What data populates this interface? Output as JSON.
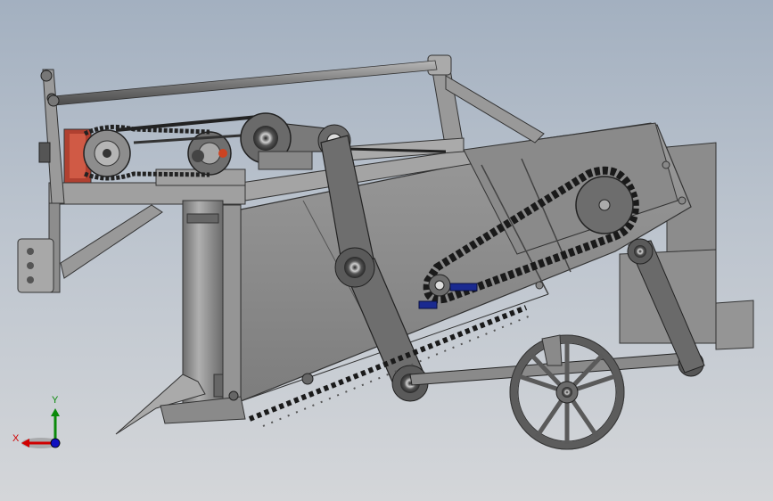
{
  "viewport": {
    "background_top": "#a3b0c0",
    "background_bottom": "#d4d6d9",
    "model": "machine-assembly",
    "icons": [
      "frame",
      "chain-drive",
      "sprocket",
      "motor",
      "link-arm",
      "spoked-wheel",
      "conveyor-chain"
    ]
  },
  "triad": {
    "x_label": "X",
    "y_label": "Y",
    "x_color": "#d00000",
    "y_color": "#0a8a0a",
    "z_color": "#1010c0"
  }
}
